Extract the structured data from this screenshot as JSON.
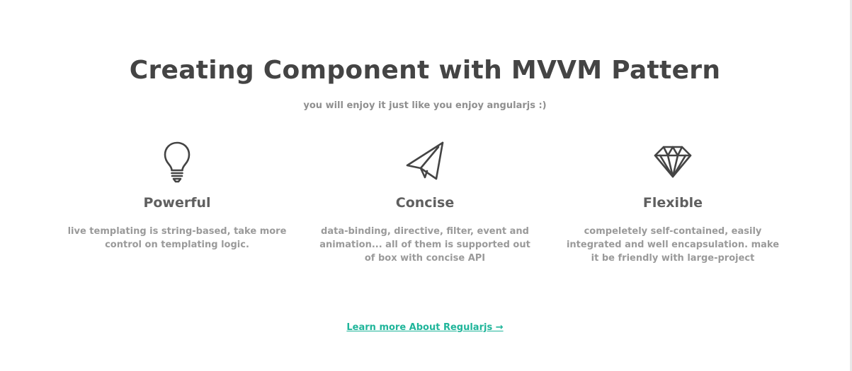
{
  "section": {
    "title": "Creating Component with MVVM Pattern",
    "subtitle": "you will enjoy it just like you enjoy angularjs :)"
  },
  "features": [
    {
      "icon": "lightbulb-icon",
      "title": "Powerful",
      "description": "live templating is string-based, take more control on templating logic."
    },
    {
      "icon": "paper-plane-icon",
      "title": "Concise",
      "description": "data-binding, directive, filter, event and animation... all of them is supported out of box with concise API"
    },
    {
      "icon": "diamond-icon",
      "title": "Flexible",
      "description": "compeletely self-contained, easily integrated and well encapsulation. make it be friendly with large-project"
    }
  ],
  "cta": {
    "label": "Learn more About Regularjs →"
  },
  "colors": {
    "title": "#444444",
    "subtitle": "#8f8f8f",
    "feature_title": "#5f5f5f",
    "feature_desc": "#9a9a9a",
    "link": "#1fb59a",
    "icon_stroke": "#444444"
  }
}
